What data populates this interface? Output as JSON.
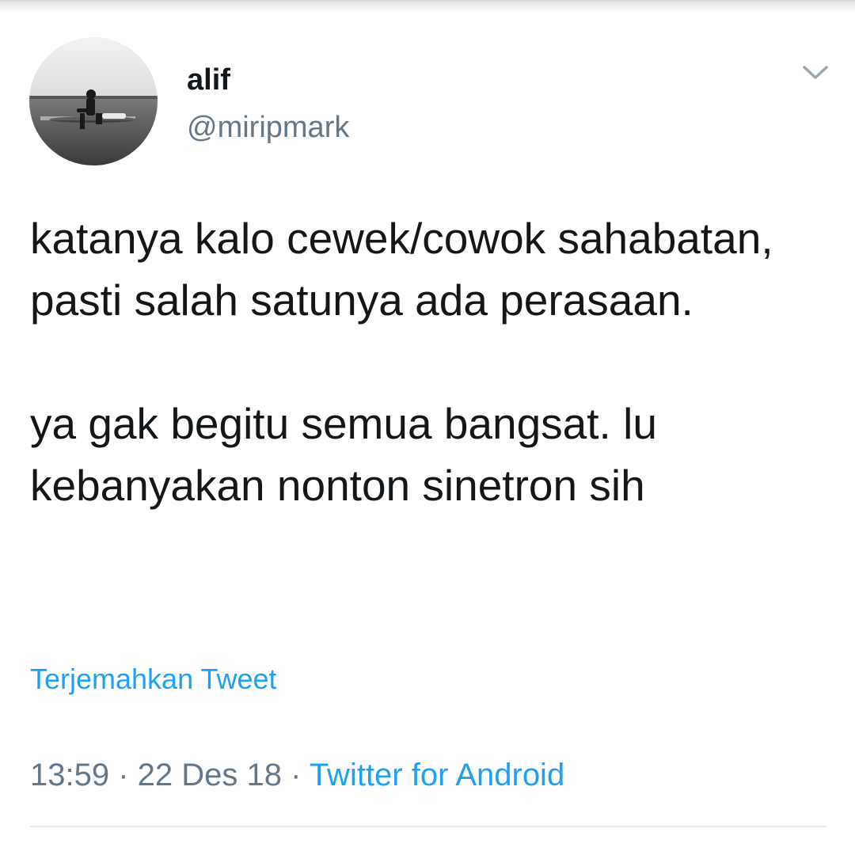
{
  "tweet": {
    "author": {
      "display_name": "alif",
      "handle": "@miripmark",
      "avatar_icon": "profile-photo"
    },
    "menu_icon": "chevron-down-icon",
    "text_paragraphs": [
      "katanya kalo cewek/cowok sahabatan, pasti salah satunya ada perasaan.",
      "ya gak begitu semua bangsat. lu kebanyakan nonton sinetron sih"
    ],
    "translate_label": "Terjemahkan Tweet",
    "time": "13:59",
    "separator": " · ",
    "date": "22 Des 18",
    "source": "Twitter for Android"
  },
  "colors": {
    "text": "#14171a",
    "secondary": "#657786",
    "accent": "#1da1f2",
    "divider": "#e6ecf0"
  }
}
